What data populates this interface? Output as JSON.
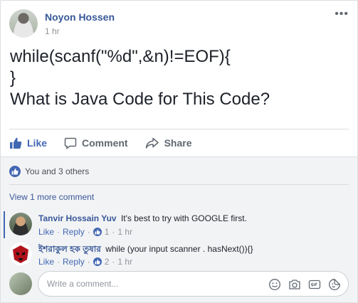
{
  "post": {
    "author": "Noyon Hossen",
    "time": "1 hr",
    "menu": "•••",
    "lines": [
      "while(scanf(\"%d\",&n)!=EOF){",
      "}",
      "What is Java Code for This Code?"
    ]
  },
  "actions": {
    "like": "Like",
    "comment": "Comment",
    "share": "Share"
  },
  "reactions": {
    "summary": "You and 3 others"
  },
  "view_more": "View 1 more comment",
  "comments": [
    {
      "author": "Tanvir Hossain Yuv",
      "text": "It's best to try with GOOGLE first.",
      "like_label": "Like",
      "reply_label": "Reply",
      "likes": "1",
      "time": "1 hr"
    },
    {
      "author": "ইশরাকুল হক তুষার",
      "text": "while (your input scanner . hasNext()){}",
      "like_label": "Like",
      "reply_label": "Reply",
      "likes": "2",
      "time": "1 hr"
    }
  ],
  "write_comment": {
    "placeholder": "Write a comment..."
  },
  "colors": {
    "brand": "#4267b2",
    "link": "#385898",
    "muted": "#90949c"
  },
  "icons": [
    "like-icon",
    "comment-icon",
    "share-icon",
    "emoji-icon",
    "camera-icon",
    "gif-icon",
    "sticker-icon"
  ]
}
